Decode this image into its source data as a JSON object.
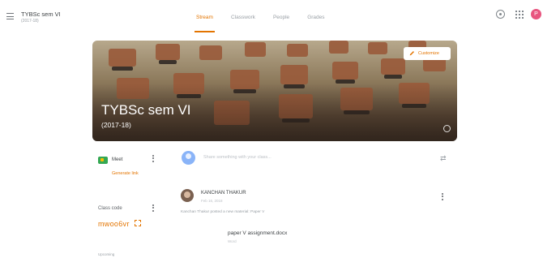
{
  "header": {
    "class_title": "TYBSc sem VI",
    "class_subtitle": "(2017-18)",
    "tabs": [
      {
        "label": "Stream",
        "active": true
      },
      {
        "label": "Classwork",
        "active": false
      },
      {
        "label": "People",
        "active": false
      },
      {
        "label": "Grades",
        "active": false
      }
    ],
    "user_initial": "P",
    "accent_color": "#e37400"
  },
  "banner": {
    "title": "TYBSc sem VI",
    "subtitle": "(2017-18)",
    "customize_label": "Customize"
  },
  "sidebar": {
    "meet_label": "Meet",
    "generate_link": "Generate link",
    "class_code_label": "Class code",
    "class_code": "mwoo6vr",
    "upcoming_label": "Upcoming"
  },
  "stream": {
    "share_placeholder": "Share something with your class...",
    "post": {
      "author": "KANCHAN THAKUR",
      "date": "Feb 16, 2018",
      "body": "Kanchan Thakur posted a new material: Paper V",
      "attachment_title": "paper V assignment.docx",
      "attachment_type": "Word"
    }
  }
}
